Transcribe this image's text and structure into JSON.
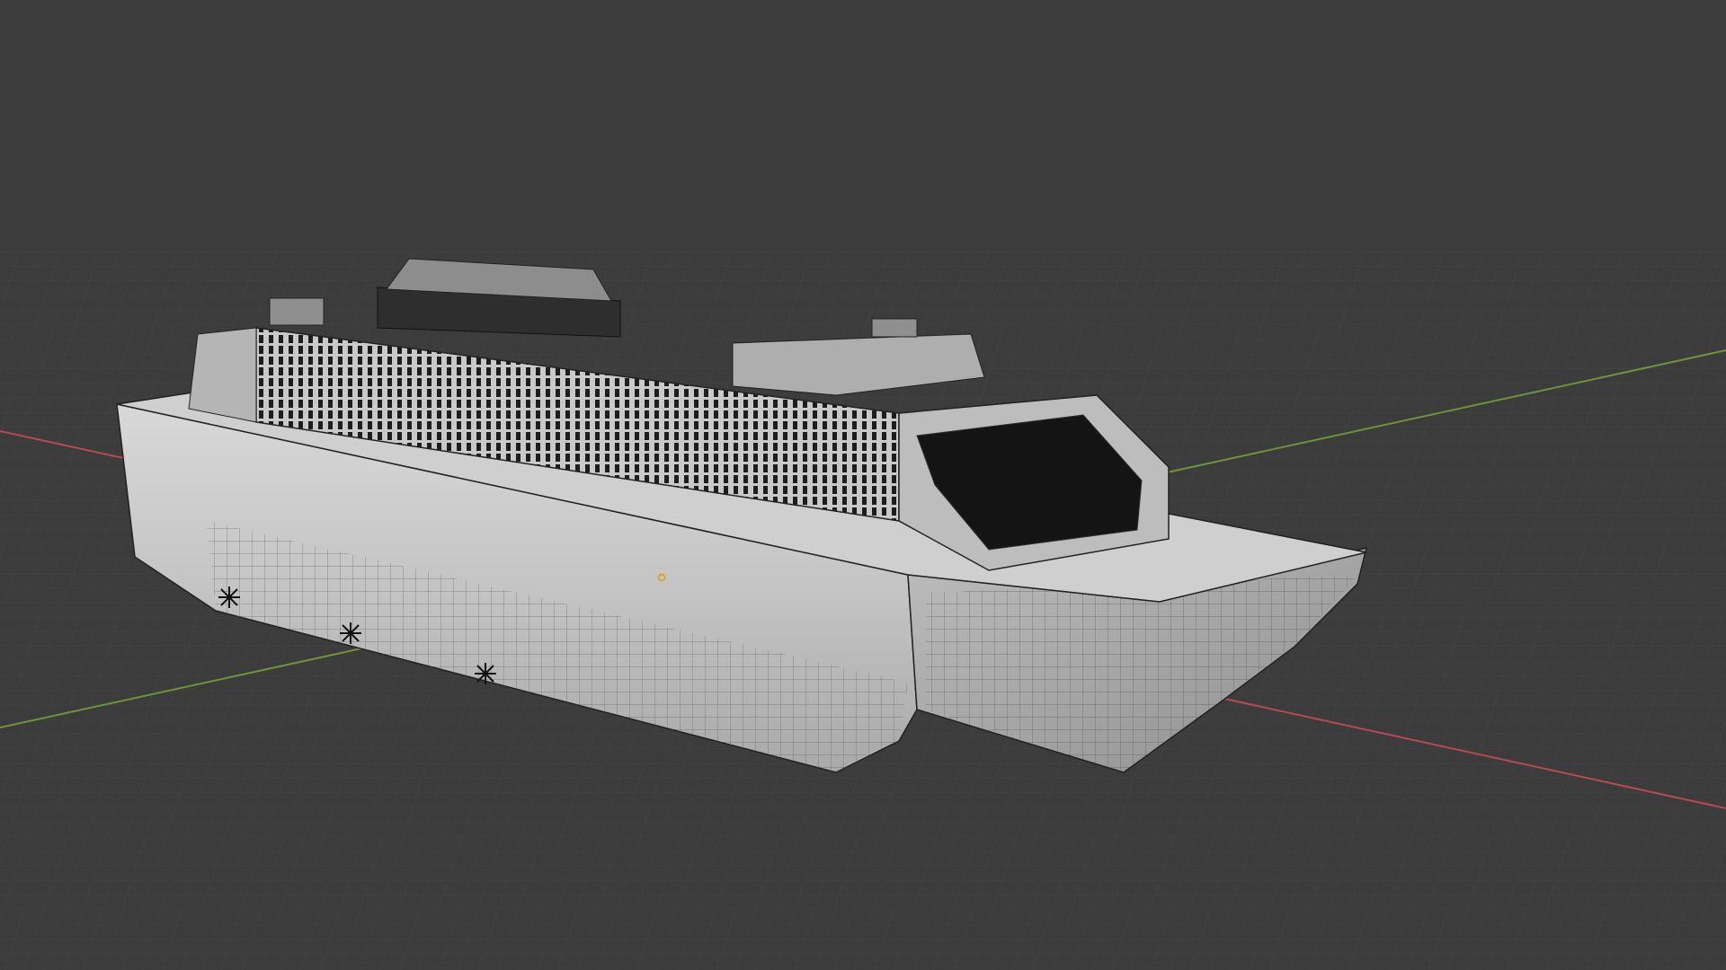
{
  "viewport": {
    "background_color": "#3d3d3d",
    "grid_color": "#4a4a4a",
    "x_axis_color": "#b84a52",
    "y_axis_color": "#6f9437",
    "origin_marker_color": "#e0a000"
  },
  "scene": {
    "object": "cruise-ship-mesh",
    "display_mode": "solid-with-wireframe",
    "propellers": 3
  }
}
